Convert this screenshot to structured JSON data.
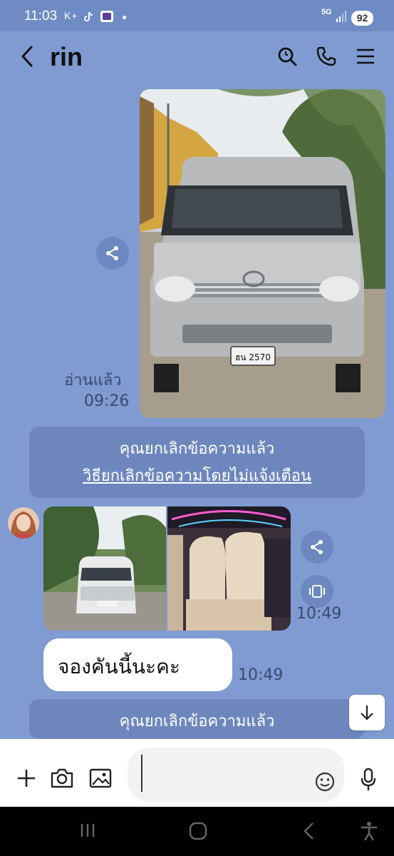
{
  "status_bar": {
    "time": "11:03",
    "extras": "K+",
    "network": "5G",
    "battery": "92"
  },
  "header": {
    "title": "rin"
  },
  "messages": {
    "read_label": "อ่านแล้ว",
    "time_1": "09:26",
    "unsent_1": {
      "text": "คุณยกเลิกข้อความแล้ว",
      "link": "วิธียกเลิกข้อความโดยไม่แจ้งเตือน"
    },
    "time_2": "10:49",
    "bubble_text": "จองคันนี้นะคะ",
    "time_3": "10:49",
    "unsent_2": {
      "text": "คุณยกเลิกข้อความแล้ว"
    },
    "van_plate": "ฮน 2570"
  },
  "colors": {
    "chat_background": "#7f9bd1",
    "accent": "#6d87bd",
    "bubble": "#ffffff"
  },
  "icons": [
    "back-icon",
    "search-icon",
    "phone-icon",
    "menu-icon",
    "share-icon",
    "expand-icon",
    "plus-icon",
    "camera-icon",
    "image-icon",
    "emoji-icon",
    "mic-icon",
    "arrow-down-icon"
  ]
}
